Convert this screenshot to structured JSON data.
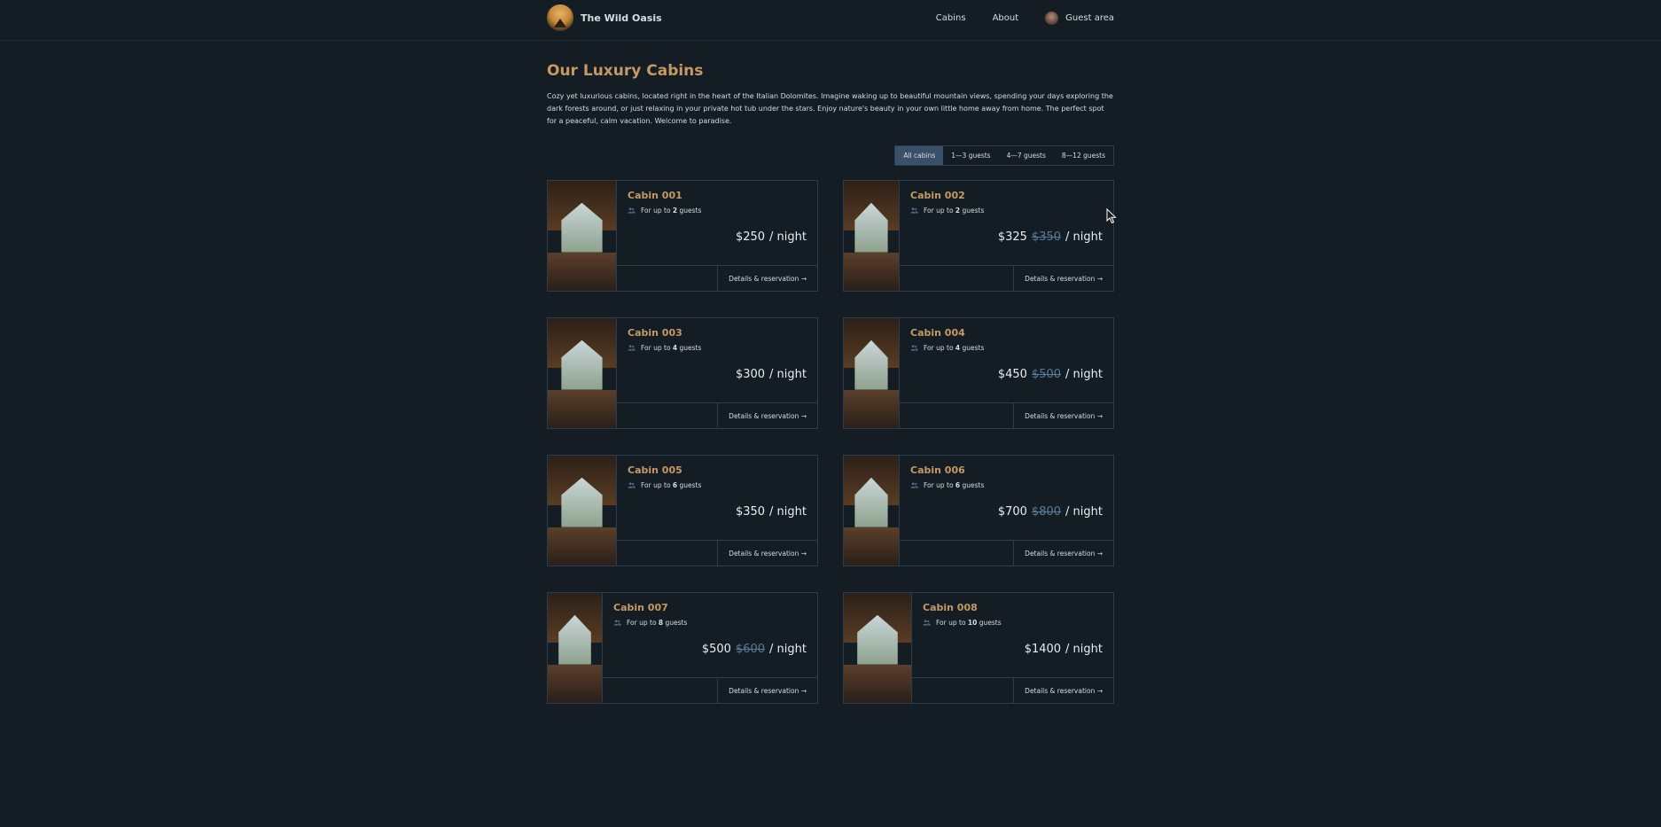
{
  "header": {
    "logo_text": "The Wild Oasis",
    "nav": [
      {
        "label": "Cabins"
      },
      {
        "label": "About"
      },
      {
        "label": "Guest area"
      }
    ]
  },
  "page": {
    "title": "Our Luxury Cabins",
    "intro": "Cozy yet luxurious cabins, located right in the heart of the Italian Dolomites. Imagine waking up to beautiful mountain views, spending your days exploring the dark forests around, or just relaxing in your private hot tub under the stars. Enjoy nature's beauty in your own little home away from home. The perfect spot for a peaceful, calm vacation. Welcome to paradise."
  },
  "filters": [
    {
      "label": "All cabins",
      "active": true
    },
    {
      "label": "1—3 guests",
      "active": false
    },
    {
      "label": "4—7 guests",
      "active": false
    },
    {
      "label": "8—12 guests",
      "active": false
    }
  ],
  "cabins": [
    {
      "name": "Cabin 001",
      "capacity_prefix": "For up to ",
      "capacity": "2",
      "capacity_suffix": " guests",
      "price": "$250",
      "old_price": "",
      "per": "/ night",
      "details": "Details & reservation →"
    },
    {
      "name": "Cabin 002",
      "capacity_prefix": "For up to ",
      "capacity": "2",
      "capacity_suffix": " guests",
      "price": "$325",
      "old_price": "$350",
      "per": "/ night",
      "details": "Details & reservation →"
    },
    {
      "name": "Cabin 003",
      "capacity_prefix": "For up to ",
      "capacity": "4",
      "capacity_suffix": " guests",
      "price": "$300",
      "old_price": "",
      "per": "/ night",
      "details": "Details & reservation →"
    },
    {
      "name": "Cabin 004",
      "capacity_prefix": "For up to ",
      "capacity": "4",
      "capacity_suffix": " guests",
      "price": "$450",
      "old_price": "$500",
      "per": "/ night",
      "details": "Details & reservation →"
    },
    {
      "name": "Cabin 005",
      "capacity_prefix": "For up to ",
      "capacity": "6",
      "capacity_suffix": " guests",
      "price": "$350",
      "old_price": "",
      "per": "/ night",
      "details": "Details & reservation →"
    },
    {
      "name": "Cabin 006",
      "capacity_prefix": "For up to ",
      "capacity": "6",
      "capacity_suffix": " guests",
      "price": "$700",
      "old_price": "$800",
      "per": "/ night",
      "details": "Details & reservation →"
    },
    {
      "name": "Cabin 007",
      "capacity_prefix": "For up to ",
      "capacity": "8",
      "capacity_suffix": " guests",
      "price": "$500",
      "old_price": "$600",
      "per": "/ night",
      "details": "Details & reservation →"
    },
    {
      "name": "Cabin 008",
      "capacity_prefix": "For up to ",
      "capacity": "10",
      "capacity_suffix": " guests",
      "price": "$1400",
      "old_price": "",
      "per": "/ night",
      "details": "Details & reservation →"
    }
  ],
  "colors": {
    "background": "#141c24",
    "accent": "#c69963",
    "border": "#2c3d4f",
    "active_filter": "#3a5068",
    "old_price": "#5b7a99"
  }
}
